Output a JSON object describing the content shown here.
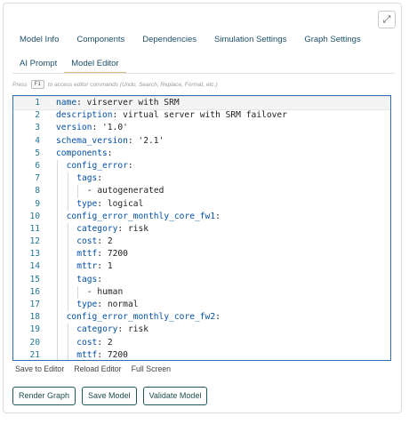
{
  "tabs_row1": [
    {
      "label": "Model Info"
    },
    {
      "label": "Components"
    },
    {
      "label": "Dependencies"
    },
    {
      "label": "Simulation Settings"
    },
    {
      "label": "Graph Settings"
    }
  ],
  "tabs_row2": [
    {
      "label": "AI Prompt"
    },
    {
      "label": "Model Editor",
      "active": true
    }
  ],
  "hint": {
    "prefix": "Press",
    "key": "F1",
    "suffix": "to access editor commands (Undo, Search, Replace, Format, etc.)"
  },
  "editor": {
    "lines": [
      {
        "n": "1",
        "indent": 0,
        "key": "name",
        "val": " virserver with SRM"
      },
      {
        "n": "2",
        "indent": 0,
        "key": "description",
        "val": " virtual server with SRM failover"
      },
      {
        "n": "3",
        "indent": 0,
        "key": "version",
        "val": " '1.0'"
      },
      {
        "n": "4",
        "indent": 0,
        "key": "schema_version",
        "val": " '2.1'"
      },
      {
        "n": "5",
        "indent": 0,
        "key": "components",
        "val": ""
      },
      {
        "n": "6",
        "indent": 1,
        "key": "config_error",
        "val": ""
      },
      {
        "n": "7",
        "indent": 2,
        "key": "tags",
        "val": ""
      },
      {
        "n": "8",
        "indent": 3,
        "key": "",
        "val": "- autogenerated"
      },
      {
        "n": "9",
        "indent": 2,
        "key": "type",
        "val": " logical"
      },
      {
        "n": "10",
        "indent": 1,
        "key": "config_error_monthly_core_fw1",
        "val": ""
      },
      {
        "n": "11",
        "indent": 2,
        "key": "category",
        "val": " risk"
      },
      {
        "n": "12",
        "indent": 2,
        "key": "cost",
        "val": " 2"
      },
      {
        "n": "13",
        "indent": 2,
        "key": "mttf",
        "val": " 7200"
      },
      {
        "n": "14",
        "indent": 2,
        "key": "mttr",
        "val": " 1"
      },
      {
        "n": "15",
        "indent": 2,
        "key": "tags",
        "val": ""
      },
      {
        "n": "16",
        "indent": 3,
        "key": "",
        "val": "- human"
      },
      {
        "n": "17",
        "indent": 2,
        "key": "type",
        "val": " normal"
      },
      {
        "n": "18",
        "indent": 1,
        "key": "config_error_monthly_core_fw2",
        "val": ""
      },
      {
        "n": "19",
        "indent": 2,
        "key": "category",
        "val": " risk"
      },
      {
        "n": "20",
        "indent": 2,
        "key": "cost",
        "val": " 2"
      },
      {
        "n": "21",
        "indent": 2,
        "key": "mttf",
        "val": " 7200"
      }
    ]
  },
  "editor_links": {
    "save": "Save to Editor",
    "reload": "Reload Editor",
    "fullscreen": "Full Screen"
  },
  "buttons": {
    "render": "Render Graph",
    "save": "Save Model",
    "validate": "Validate Model"
  },
  "icons": {
    "expand": "expand-arrows-icon"
  }
}
